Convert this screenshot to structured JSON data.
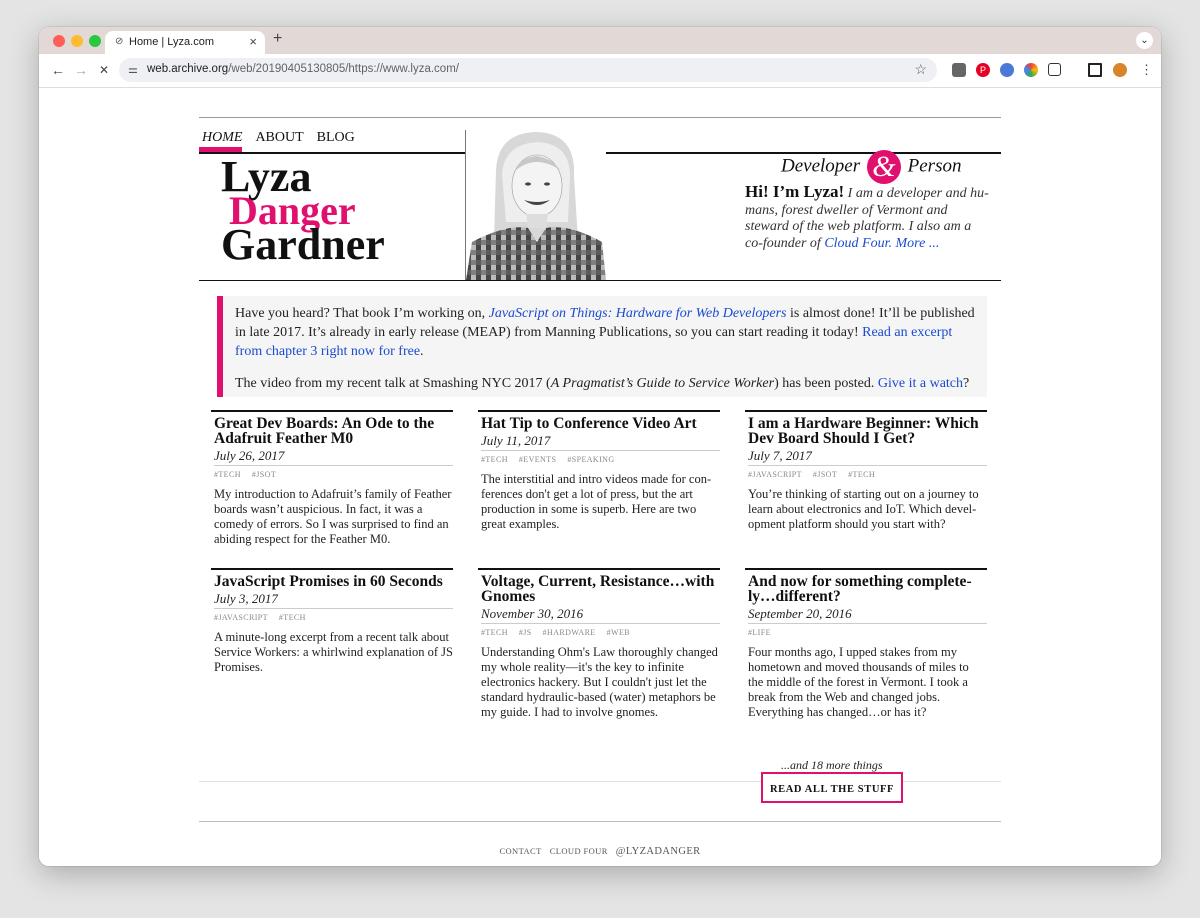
{
  "browser": {
    "tab_title": "Home | Lyza.com",
    "tab_close": "×",
    "new_tab": "+",
    "tab_menu": "⌄",
    "url_domain": "web.archive.org",
    "url_path": "/web/20190405130805/https://www.lyza.com/",
    "back": "←",
    "forward": "→",
    "stop": "✕",
    "star": "☆"
  },
  "nav": {
    "items": [
      "HOME",
      "ABOUT",
      "BLOG"
    ]
  },
  "header": {
    "logo": [
      "Lyza",
      "Danger",
      "Gardner"
    ],
    "tagline_left": "Developer",
    "tagline_amp": "&",
    "tagline_right": "Person",
    "hi": "Hi! I’m Lyza!",
    "intro": " I am a developer and hu­mans, forest dweller of Vermont and steward of the web platform. I also am a co-founder of ",
    "intro_link": "Cloud Four.",
    "more_link": "More ..."
  },
  "callout": {
    "p1_a": "Have you heard? That book I’m working on, ",
    "p1_book": "JavaScript on Things: Hardware for Web Developers",
    "p1_b": " is almost done! It’ll be published in late 2017. It’s already in early release (MEAP) from Manning Publications, so you can start reading it today! ",
    "p1_link": "Read an excerpt from chapter 3 right now for free",
    "p1_end": ".",
    "p2_a": "The video from my recent talk at Smashing NYC 2017 (",
    "p2_title": "A Pragmatist’s Guide to Service Worker",
    "p2_b": ") has been posted. ",
    "p2_link": "Give it a watch",
    "p2_end": "?"
  },
  "posts": [
    {
      "title": "Great Dev Boards: An Ode to the Adafruit Feather M0",
      "date": "July 26, 2017",
      "tags": [
        "#TECH",
        "#JSOT"
      ],
      "excerpt": "My introduction to Adafruit’s family of Feather boards wasn’t auspicious. In fact, it was a comedy of errors. So I was surprised to find an abiding respect for the Feather M0."
    },
    {
      "title": "Hat Tip to Conference Video Art",
      "date": "July 11, 2017",
      "tags": [
        "#TECH",
        "#EVENTS",
        "#SPEAKING"
      ],
      "excerpt": "The interstitial and intro videos made for con­ferences don't get a lot of press, but the art production in some is superb. Here are two great examples."
    },
    {
      "title": "I am a Hardware Beginner: Which Dev Board Should I Get?",
      "date": "July 7, 2017",
      "tags": [
        "#JAVASCRIPT",
        "#JSOT",
        "#TECH"
      ],
      "excerpt": "You’re thinking of starting out on a journey to learn about electronics and IoT. Which devel­opment platform should you start with?"
    },
    {
      "title": "JavaScript Promises in 60 Seconds",
      "date": "July 3, 2017",
      "tags": [
        "#JAVASCRIPT",
        "#TECH"
      ],
      "excerpt": "A minute-long excerpt from a recent talk about Service Workers: a whirlwind explanation of JS Promises."
    },
    {
      "title": "Voltage, Current, Resistance…with Gnomes",
      "date": "November 30, 2016",
      "tags": [
        "#TECH",
        "#JS",
        "#HARDWARE",
        "#WEB"
      ],
      "excerpt": "Understanding Ohm's Law thoroughly changed my whole reality—it's the key to infi­nite electronics hackery. But I couldn't just let the standard hydraulic-based (water) metaphors be my guide. I had to involve gnomes."
    },
    {
      "title": "And now for something complete­ly…different?",
      "date": "September 20, 2016",
      "tags": [
        "#LIFE"
      ],
      "excerpt": "Four months ago, I upped stakes from my hometown and moved thousands of miles to the middle of the forest in Vermont. I took a break from the Web and changed jobs. Everything has changed…or has it?"
    }
  ],
  "more_things": "...and 18 more things",
  "read_all": "READ ALL THE STUFF",
  "footer": [
    "CONTACT",
    "CLOUD FOUR",
    "@LYZADANGER"
  ]
}
